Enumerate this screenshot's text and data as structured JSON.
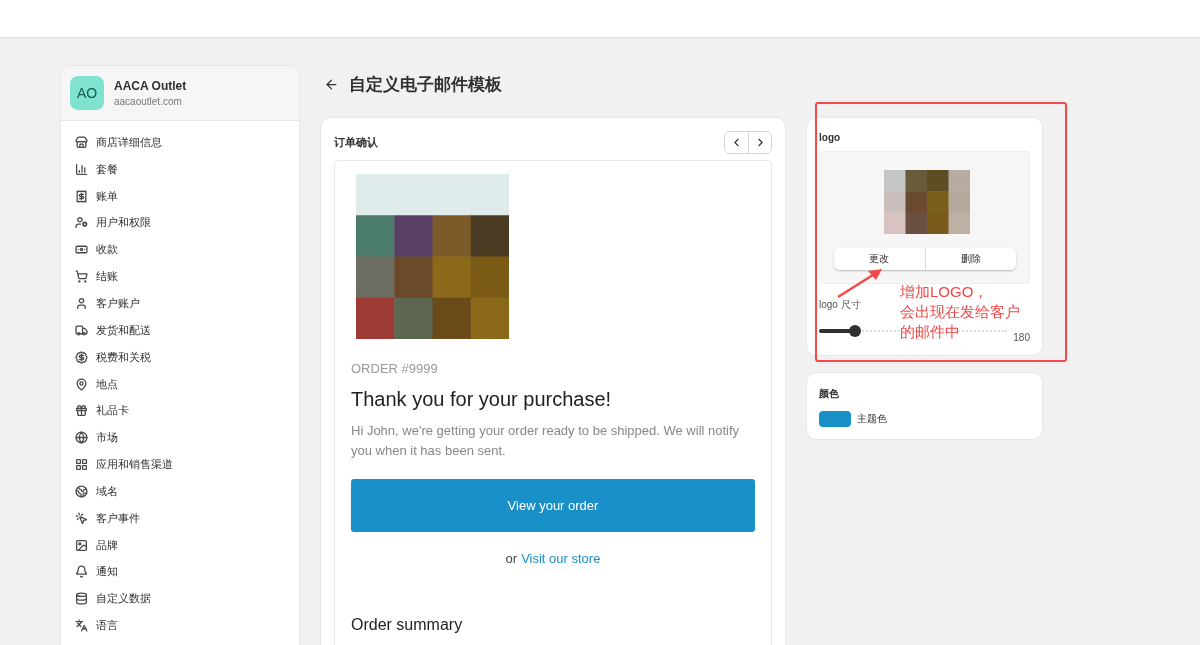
{
  "store": {
    "initials": "AO",
    "name": "AACA Outlet",
    "domain": "aacaoutlet.com"
  },
  "sidebar": {
    "items": [
      {
        "label": "商店详细信息"
      },
      {
        "label": "套餐"
      },
      {
        "label": "账单"
      },
      {
        "label": "用户和权限"
      },
      {
        "label": "收款"
      },
      {
        "label": "结账"
      },
      {
        "label": "客户账户"
      },
      {
        "label": "发货和配送"
      },
      {
        "label": "税费和关税"
      },
      {
        "label": "地点"
      },
      {
        "label": "礼品卡"
      },
      {
        "label": "市场"
      },
      {
        "label": "应用和销售渠道"
      },
      {
        "label": "域名"
      },
      {
        "label": "客户事件"
      },
      {
        "label": "品牌"
      },
      {
        "label": "通知"
      },
      {
        "label": "自定义数据"
      },
      {
        "label": "语言"
      }
    ]
  },
  "page": {
    "title": "自定义电子邮件模板"
  },
  "preview": {
    "template": "订单确认",
    "email": {
      "order_number": "ORDER #9999",
      "heading": "Thank you for your purchase!",
      "message": "Hi John, we're getting your order ready to be shipped. We will notify you when it has been sent.",
      "button": "View your order",
      "or": "or",
      "link": "Visit our store",
      "summary": "Order summary"
    }
  },
  "logo_card": {
    "title": "logo",
    "buttons": [
      "更改",
      "删除"
    ],
    "size_label": "logo 尺寸",
    "size": {
      "level": 0.19,
      "reading": "180"
    }
  },
  "color_card": {
    "title": "颜色",
    "swatches": [
      {
        "label": "主题色",
        "color": "#1a90c8"
      }
    ]
  },
  "annotation": {
    "lines": [
      "增加LOGO，",
      "会出现在发给客户",
      "的邮件中"
    ]
  }
}
